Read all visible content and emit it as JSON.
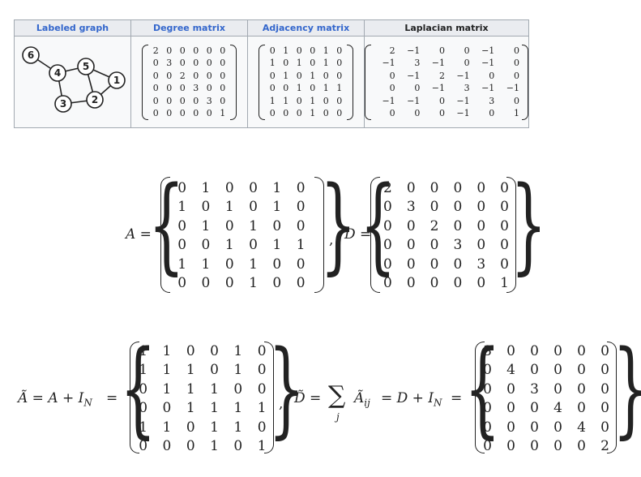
{
  "table": {
    "headers": {
      "graph": "Labeled graph",
      "degree": "Degree matrix",
      "adjacency": "Adjacency matrix",
      "laplacian": "Laplacian matrix"
    },
    "graph_nodes": [
      "1",
      "2",
      "3",
      "4",
      "5",
      "6"
    ],
    "degree_rows": [
      [
        "2",
        "0",
        "0",
        "0",
        "0",
        "0"
      ],
      [
        "0",
        "3",
        "0",
        "0",
        "0",
        "0"
      ],
      [
        "0",
        "0",
        "2",
        "0",
        "0",
        "0"
      ],
      [
        "0",
        "0",
        "0",
        "3",
        "0",
        "0"
      ],
      [
        "0",
        "0",
        "0",
        "0",
        "3",
        "0"
      ],
      [
        "0",
        "0",
        "0",
        "0",
        "0",
        "1"
      ]
    ],
    "adjacency_rows": [
      [
        "0",
        "1",
        "0",
        "0",
        "1",
        "0"
      ],
      [
        "1",
        "0",
        "1",
        "0",
        "1",
        "0"
      ],
      [
        "0",
        "1",
        "0",
        "1",
        "0",
        "0"
      ],
      [
        "0",
        "0",
        "1",
        "0",
        "1",
        "1"
      ],
      [
        "1",
        "1",
        "0",
        "1",
        "0",
        "0"
      ],
      [
        "0",
        "0",
        "0",
        "1",
        "0",
        "0"
      ]
    ],
    "laplacian_rows": [
      [
        "2",
        "−1",
        "0",
        "0",
        "−1",
        "0"
      ],
      [
        "−1",
        "3",
        "−1",
        "0",
        "−1",
        "0"
      ],
      [
        "0",
        "−1",
        "2",
        "−1",
        "0",
        "0"
      ],
      [
        "0",
        "0",
        "−1",
        "3",
        "−1",
        "−1"
      ],
      [
        "−1",
        "−1",
        "0",
        "−1",
        "3",
        "0"
      ],
      [
        "0",
        "0",
        "0",
        "−1",
        "0",
        "1"
      ]
    ]
  },
  "eq1": {
    "a_label": "A =",
    "comma": ",",
    "d_label": "D =",
    "A_rows": [
      [
        "0",
        "1",
        "0",
        "0",
        "1",
        "0"
      ],
      [
        "1",
        "0",
        "1",
        "0",
        "1",
        "0"
      ],
      [
        "0",
        "1",
        "0",
        "1",
        "0",
        "0"
      ],
      [
        "0",
        "0",
        "1",
        "0",
        "1",
        "1"
      ],
      [
        "1",
        "1",
        "0",
        "1",
        "0",
        "0"
      ],
      [
        "0",
        "0",
        "0",
        "1",
        "0",
        "0"
      ]
    ],
    "D_rows": [
      [
        "2",
        "0",
        "0",
        "0",
        "0",
        "0"
      ],
      [
        "0",
        "3",
        "0",
        "0",
        "0",
        "0"
      ],
      [
        "0",
        "0",
        "2",
        "0",
        "0",
        "0"
      ],
      [
        "0",
        "0",
        "0",
        "3",
        "0",
        "0"
      ],
      [
        "0",
        "0",
        "0",
        "0",
        "3",
        "0"
      ],
      [
        "0",
        "0",
        "0",
        "0",
        "0",
        "1"
      ]
    ]
  },
  "eq2": {
    "atilde_label": "Ã = A + I",
    "atilde_sub": "N",
    "eq": "=",
    "comma": ",",
    "dtilde_label": "D̃ =",
    "sum_symbol": "∑",
    "sum_index": "j",
    "sum_term": "Ã",
    "sum_term_sub": "ij",
    "rest": "= D + I",
    "rest_sub": "N",
    "rest_eq": "=",
    "Atilde_rows": [
      [
        "1",
        "1",
        "0",
        "0",
        "1",
        "0"
      ],
      [
        "1",
        "1",
        "1",
        "0",
        "1",
        "0"
      ],
      [
        "0",
        "1",
        "1",
        "1",
        "0",
        "0"
      ],
      [
        "0",
        "0",
        "1",
        "1",
        "1",
        "1"
      ],
      [
        "1",
        "1",
        "0",
        "1",
        "1",
        "0"
      ],
      [
        "0",
        "0",
        "0",
        "1",
        "0",
        "1"
      ]
    ],
    "Dtilde_rows": [
      [
        "3",
        "0",
        "0",
        "0",
        "0",
        "0"
      ],
      [
        "0",
        "4",
        "0",
        "0",
        "0",
        "0"
      ],
      [
        "0",
        "0",
        "3",
        "0",
        "0",
        "0"
      ],
      [
        "0",
        "0",
        "0",
        "4",
        "0",
        "0"
      ],
      [
        "0",
        "0",
        "0",
        "0",
        "4",
        "0"
      ],
      [
        "0",
        "0",
        "0",
        "0",
        "0",
        "2"
      ]
    ]
  }
}
